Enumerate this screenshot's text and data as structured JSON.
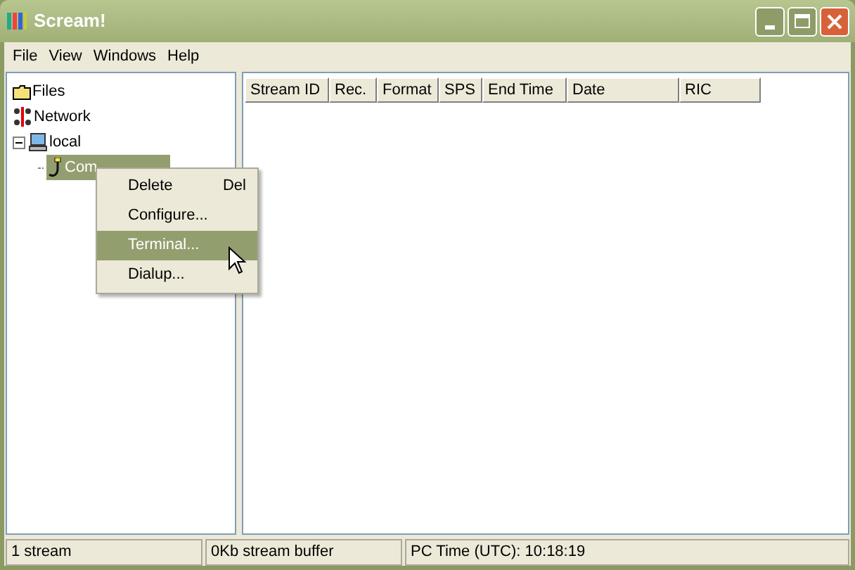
{
  "window": {
    "title": "Scream!"
  },
  "menu": [
    "File",
    "View",
    "Windows",
    "Help"
  ],
  "tree": [
    {
      "label": "Files",
      "kind": "folder",
      "selected": false
    },
    {
      "label": "Network",
      "kind": "network",
      "selected": false
    },
    {
      "label": "local",
      "kind": "computer",
      "selected": false,
      "expanded": true,
      "children": [
        {
          "label": "Com",
          "kind": "port",
          "selected": true
        }
      ]
    }
  ],
  "context_menu": [
    {
      "label": "Delete",
      "shortcut": "Del",
      "selected": false
    },
    {
      "label": "Configure...",
      "selected": false
    },
    {
      "label": "Terminal...",
      "selected": true
    },
    {
      "label": "Dialup...",
      "selected": false
    }
  ],
  "table": {
    "columns": [
      "Stream ID",
      "Rec.",
      "Format",
      "SPS",
      "End Time",
      "Date",
      "RIC"
    ]
  },
  "status_bar": [
    "1 stream",
    "0Kb stream buffer",
    "PC Time (UTC):  10:18:19"
  ]
}
